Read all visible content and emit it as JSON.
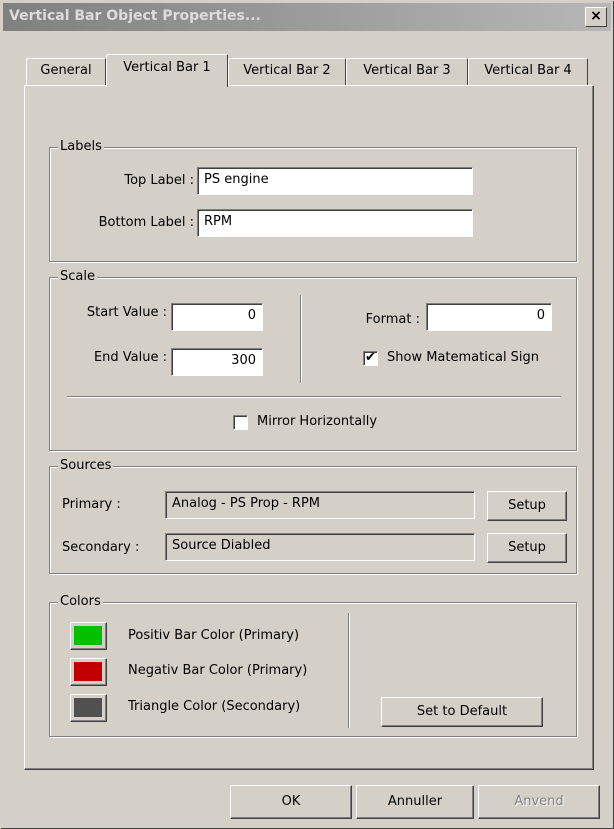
{
  "window": {
    "title": "Vertical Bar Object Properties...",
    "close_glyph": "×"
  },
  "tabs": [
    {
      "label": "General"
    },
    {
      "label": "Vertical Bar 1",
      "active": true
    },
    {
      "label": "Vertical Bar 2"
    },
    {
      "label": "Vertical Bar 3"
    },
    {
      "label": "Vertical Bar 4"
    }
  ],
  "labels_group": {
    "title": "Labels",
    "top_label": "Top Label :",
    "top_value": "PS engine",
    "bottom_label": "Bottom Label :",
    "bottom_value": "RPM"
  },
  "scale_group": {
    "title": "Scale",
    "start_label": "Start Value :",
    "start_value": "0",
    "end_label": "End Value :",
    "end_value": "300",
    "format_label": "Format :",
    "format_value": "0",
    "show_sign_label": "Show Matematical Sign",
    "show_sign_checked": true,
    "mirror_label": "Mirror Horizontally",
    "mirror_checked": false,
    "check_glyph": "✔"
  },
  "sources_group": {
    "title": "Sources",
    "primary_label": "Primary :",
    "primary_value": "Analog - PS Prop - RPM",
    "secondary_label": "Secondary :",
    "secondary_value": "Source Diabled",
    "setup_label": "Setup"
  },
  "colors_group": {
    "title": "Colors",
    "items": [
      {
        "label": "Positiv Bar Color (Primary)",
        "color": "#00c000"
      },
      {
        "label": "Negativ Bar Color (Primary)",
        "color": "#c00000"
      },
      {
        "label": "Triangle Color (Secondary)",
        "color": "#505050"
      }
    ],
    "default_button": "Set to Default"
  },
  "footer": {
    "ok": "OK",
    "cancel": "Annuller",
    "apply": "Anvend"
  }
}
